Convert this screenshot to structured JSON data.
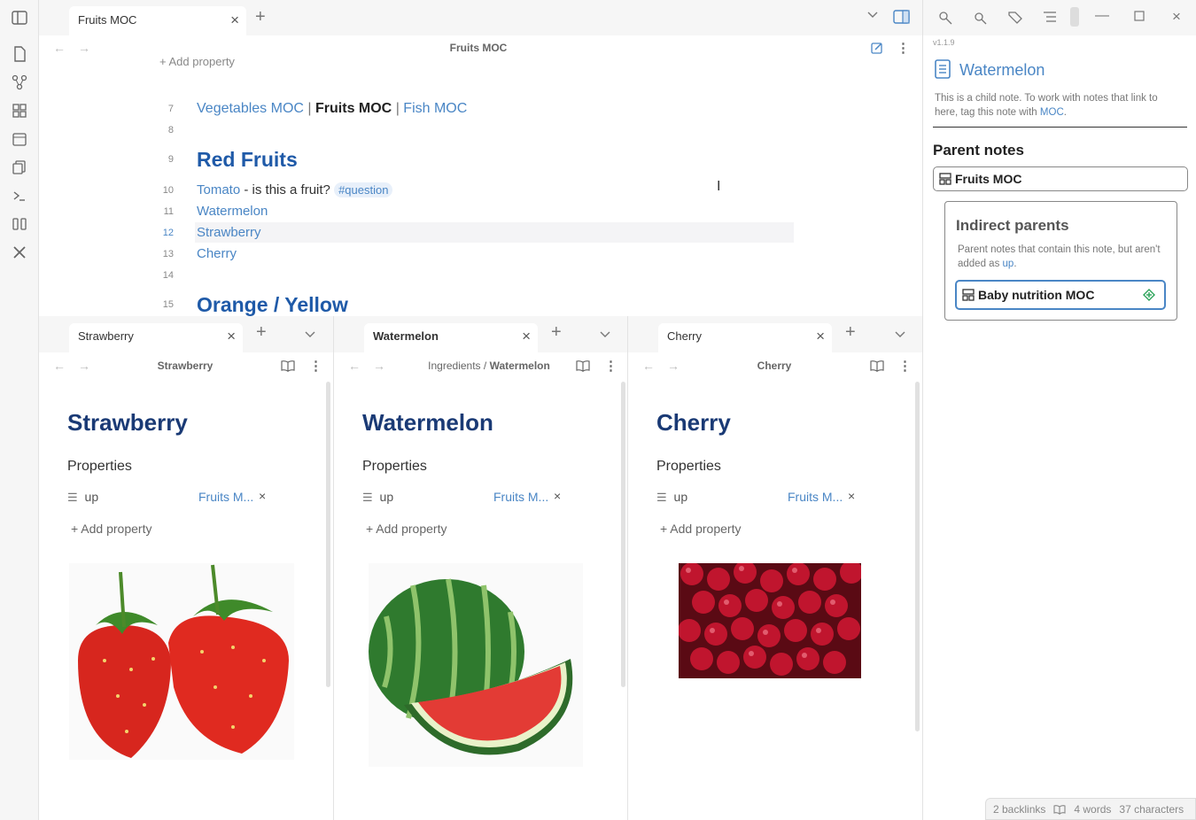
{
  "main_tab": {
    "title": "Fruits MOC"
  },
  "main_header": {
    "title": "Fruits MOC",
    "add_property": "Add property"
  },
  "editor": {
    "line_numbers": [
      "7",
      "8",
      "9",
      "10",
      "11",
      "12",
      "13",
      "14",
      "15"
    ],
    "nav_links": {
      "vegetables": "Vegetables MOC",
      "sep1": "|",
      "fruits": "Fruits MOC",
      "sep2": "|",
      "fish": "Fish MOC"
    },
    "heading_red": "Red Fruits",
    "tomato": "Tomato",
    "tomato_text": "- is this a fruit?",
    "tag": "#question",
    "items": [
      "Watermelon",
      "Strawberry",
      "Cherry"
    ],
    "heading_orange": "Orange / Yellow"
  },
  "panes": [
    {
      "tab": "Strawberry",
      "header": "Strawberry",
      "breadcrumb_parent": "",
      "breadcrumb_sep": "",
      "title": "Strawberry",
      "properties_label": "Properties",
      "prop_key": "up",
      "prop_value": "Fruits M...",
      "add_property": "Add property",
      "image": "strawberry"
    },
    {
      "tab": "Watermelon",
      "header": "Watermelon",
      "breadcrumb_parent": "Ingredients",
      "breadcrumb_sep": "/",
      "title": "Watermelon",
      "properties_label": "Properties",
      "prop_key": "up",
      "prop_value": "Fruits M...",
      "add_property": "Add property",
      "image": "watermelon"
    },
    {
      "tab": "Cherry",
      "header": "Cherry",
      "breadcrumb_parent": "",
      "breadcrumb_sep": "",
      "title": "Cherry",
      "properties_label": "Properties",
      "prop_key": "up",
      "prop_value": "Fruits M...",
      "add_property": "Add property",
      "image": "cherry"
    }
  ],
  "right_panel": {
    "version": "v1.1.9",
    "note_title": "Watermelon",
    "description_prefix": "This is a child note. To work with notes that link to here, tag this note with",
    "description_link": "MOC",
    "description_end": ".",
    "parent_notes_heading": "Parent notes",
    "parent_note": "Fruits MOC",
    "indirect_heading": "Indirect parents",
    "indirect_desc_prefix": "Parent notes that contain this note, but aren't added as",
    "indirect_desc_link": "up",
    "indirect_desc_end": ".",
    "indirect_note": "Baby nutrition MOC"
  },
  "status": {
    "backlinks": "2 backlinks",
    "words": "4 words",
    "characters": "37 characters"
  },
  "colors": {
    "accent": "#4a86c5",
    "heading": "#1f5aa8",
    "title": "#1a3a75"
  }
}
